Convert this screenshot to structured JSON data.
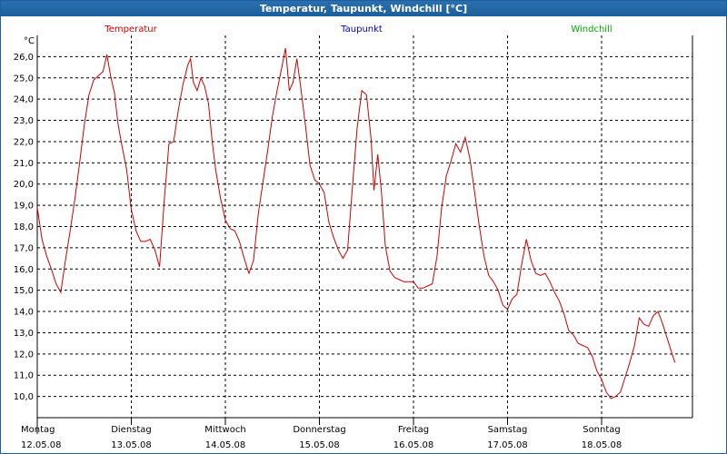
{
  "window": {
    "title": "Temperatur, Taupunkt, Windchill [°C]"
  },
  "chart_data": {
    "type": "line",
    "unit": "°C",
    "ylim": [
      9.0,
      27.0
    ],
    "yticks": [
      10.0,
      11.0,
      12.0,
      13.0,
      14.0,
      15.0,
      16.0,
      17.0,
      18.0,
      19.0,
      20.0,
      21.0,
      22.0,
      23.0,
      24.0,
      25.0,
      26.0
    ],
    "ytick_labels": [
      "10,0",
      "11,0",
      "12,0",
      "13,0",
      "14,0",
      "15,0",
      "16,0",
      "17,0",
      "18,0",
      "19,0",
      "20,0",
      "21,0",
      "22,0",
      "23,0",
      "24,0",
      "25,0",
      "26,0"
    ],
    "grid": true,
    "legend_position": "top",
    "legend": [
      {
        "name": "Temperatur",
        "color": "#cc0000"
      },
      {
        "name": "Taupunkt",
        "color": "#0000cc"
      },
      {
        "name": "Windchill",
        "color": "#00aa00"
      }
    ],
    "xlim": [
      0,
      7.0
    ],
    "x_ticks": [
      {
        "x": 0,
        "day": "Montag",
        "date": "12.05.08"
      },
      {
        "x": 1,
        "day": "Dienstag",
        "date": "13.05.08"
      },
      {
        "x": 2,
        "day": "Mittwoch",
        "date": "14.05.08"
      },
      {
        "x": 3,
        "day": "Donnerstag",
        "date": "15.05.08"
      },
      {
        "x": 4,
        "day": "Freitag",
        "date": "16.05.08"
      },
      {
        "x": 5,
        "day": "Samstag",
        "date": "17.05.08"
      },
      {
        "x": 6,
        "day": "Sonntag",
        "date": "18.05.08"
      }
    ],
    "series": [
      {
        "name": "Temperatur",
        "color": "#cc0000",
        "points": [
          [
            0.0,
            18.9
          ],
          [
            0.05,
            17.4
          ],
          [
            0.1,
            16.6
          ],
          [
            0.15,
            16.0
          ],
          [
            0.2,
            15.3
          ],
          [
            0.25,
            14.9
          ],
          [
            0.3,
            16.4
          ],
          [
            0.35,
            17.8
          ],
          [
            0.4,
            19.3
          ],
          [
            0.45,
            21.0
          ],
          [
            0.5,
            22.8
          ],
          [
            0.55,
            24.2
          ],
          [
            0.6,
            24.9
          ],
          [
            0.65,
            25.1
          ],
          [
            0.7,
            25.3
          ],
          [
            0.74,
            26.1
          ],
          [
            0.78,
            25.1
          ],
          [
            0.82,
            24.3
          ],
          [
            0.86,
            22.8
          ],
          [
            0.9,
            21.8
          ],
          [
            0.95,
            20.7
          ],
          [
            1.0,
            18.8
          ],
          [
            1.05,
            17.8
          ],
          [
            1.1,
            17.3
          ],
          [
            1.15,
            17.3
          ],
          [
            1.2,
            17.4
          ],
          [
            1.25,
            16.9
          ],
          [
            1.3,
            16.1
          ],
          [
            1.35,
            19.2
          ],
          [
            1.4,
            21.9
          ],
          [
            1.45,
            22.0
          ],
          [
            1.5,
            23.5
          ],
          [
            1.55,
            24.7
          ],
          [
            1.6,
            25.6
          ],
          [
            1.63,
            25.9
          ],
          [
            1.66,
            24.8
          ],
          [
            1.7,
            24.4
          ],
          [
            1.74,
            25.0
          ],
          [
            1.78,
            24.6
          ],
          [
            1.82,
            23.8
          ],
          [
            1.86,
            22.0
          ],
          [
            1.9,
            20.6
          ],
          [
            1.95,
            19.3
          ],
          [
            2.0,
            18.3
          ],
          [
            2.05,
            17.9
          ],
          [
            2.1,
            17.8
          ],
          [
            2.15,
            17.3
          ],
          [
            2.2,
            16.5
          ],
          [
            2.25,
            15.8
          ],
          [
            2.3,
            16.4
          ],
          [
            2.35,
            18.6
          ],
          [
            2.4,
            20.1
          ],
          [
            2.45,
            21.6
          ],
          [
            2.5,
            23.2
          ],
          [
            2.55,
            24.4
          ],
          [
            2.6,
            25.5
          ],
          [
            2.64,
            26.4
          ],
          [
            2.68,
            24.4
          ],
          [
            2.72,
            24.8
          ],
          [
            2.76,
            25.9
          ],
          [
            2.8,
            24.6
          ],
          [
            2.85,
            22.8
          ],
          [
            2.9,
            20.9
          ],
          [
            2.95,
            20.2
          ],
          [
            3.0,
            20.0
          ],
          [
            3.05,
            19.6
          ],
          [
            3.1,
            18.2
          ],
          [
            3.15,
            17.5
          ],
          [
            3.2,
            16.9
          ],
          [
            3.25,
            16.5
          ],
          [
            3.3,
            16.9
          ],
          [
            3.35,
            19.8
          ],
          [
            3.4,
            22.6
          ],
          [
            3.45,
            24.4
          ],
          [
            3.5,
            24.2
          ],
          [
            3.55,
            22.1
          ],
          [
            3.58,
            19.7
          ],
          [
            3.62,
            21.4
          ],
          [
            3.66,
            19.6
          ],
          [
            3.7,
            17.1
          ],
          [
            3.75,
            15.9
          ],
          [
            3.8,
            15.6
          ],
          [
            3.85,
            15.5
          ],
          [
            3.9,
            15.4
          ],
          [
            3.95,
            15.4
          ],
          [
            4.0,
            15.4
          ],
          [
            4.05,
            15.1
          ],
          [
            4.1,
            15.1
          ],
          [
            4.15,
            15.2
          ],
          [
            4.2,
            15.3
          ],
          [
            4.25,
            16.6
          ],
          [
            4.3,
            18.9
          ],
          [
            4.35,
            20.4
          ],
          [
            4.4,
            21.1
          ],
          [
            4.45,
            21.9
          ],
          [
            4.5,
            21.5
          ],
          [
            4.55,
            22.2
          ],
          [
            4.6,
            21.2
          ],
          [
            4.65,
            19.6
          ],
          [
            4.7,
            18.0
          ],
          [
            4.75,
            16.6
          ],
          [
            4.8,
            15.7
          ],
          [
            4.85,
            15.4
          ],
          [
            4.9,
            15.0
          ],
          [
            4.95,
            14.3
          ],
          [
            5.0,
            14.1
          ],
          [
            5.05,
            14.6
          ],
          [
            5.1,
            14.8
          ],
          [
            5.15,
            16.2
          ],
          [
            5.2,
            17.4
          ],
          [
            5.25,
            16.4
          ],
          [
            5.3,
            15.8
          ],
          [
            5.35,
            15.7
          ],
          [
            5.4,
            15.8
          ],
          [
            5.45,
            15.4
          ],
          [
            5.5,
            14.9
          ],
          [
            5.55,
            14.5
          ],
          [
            5.6,
            13.9
          ],
          [
            5.65,
            13.1
          ],
          [
            5.7,
            12.9
          ],
          [
            5.75,
            12.5
          ],
          [
            5.8,
            12.4
          ],
          [
            5.85,
            12.3
          ],
          [
            5.9,
            11.9
          ],
          [
            5.95,
            11.2
          ],
          [
            6.0,
            10.8
          ],
          [
            6.05,
            10.2
          ],
          [
            6.1,
            9.9
          ],
          [
            6.15,
            10.0
          ],
          [
            6.2,
            10.2
          ],
          [
            6.25,
            10.9
          ],
          [
            6.3,
            11.6
          ],
          [
            6.35,
            12.4
          ],
          [
            6.4,
            13.7
          ],
          [
            6.45,
            13.4
          ],
          [
            6.5,
            13.3
          ],
          [
            6.55,
            13.8
          ],
          [
            6.6,
            14.0
          ],
          [
            6.65,
            13.4
          ],
          [
            6.7,
            12.7
          ],
          [
            6.75,
            12.0
          ],
          [
            6.78,
            11.6
          ]
        ]
      }
    ]
  }
}
